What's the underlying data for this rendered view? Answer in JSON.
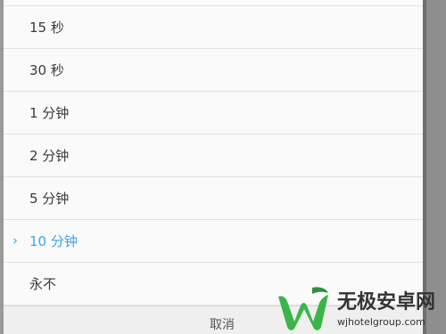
{
  "options": [
    {
      "label": "15 秒",
      "selected": false
    },
    {
      "label": "30 秒",
      "selected": false
    },
    {
      "label": "1 分钟",
      "selected": false
    },
    {
      "label": "2 分钟",
      "selected": false
    },
    {
      "label": "5 分钟",
      "selected": false
    },
    {
      "label": "10 分钟",
      "selected": true
    },
    {
      "label": "永不",
      "selected": false
    }
  ],
  "check_glyph": "›",
  "cancel_label": "取消",
  "watermark": {
    "title": "无极安卓网",
    "url": "wjhotelgroup.com"
  },
  "colors": {
    "accent": "#3ba4e8",
    "text": "#3a3a3a",
    "watermark_green": "#3cb44a"
  },
  "icons": {
    "selected": "check-chevron-icon",
    "watermark": "w-logo-icon"
  }
}
